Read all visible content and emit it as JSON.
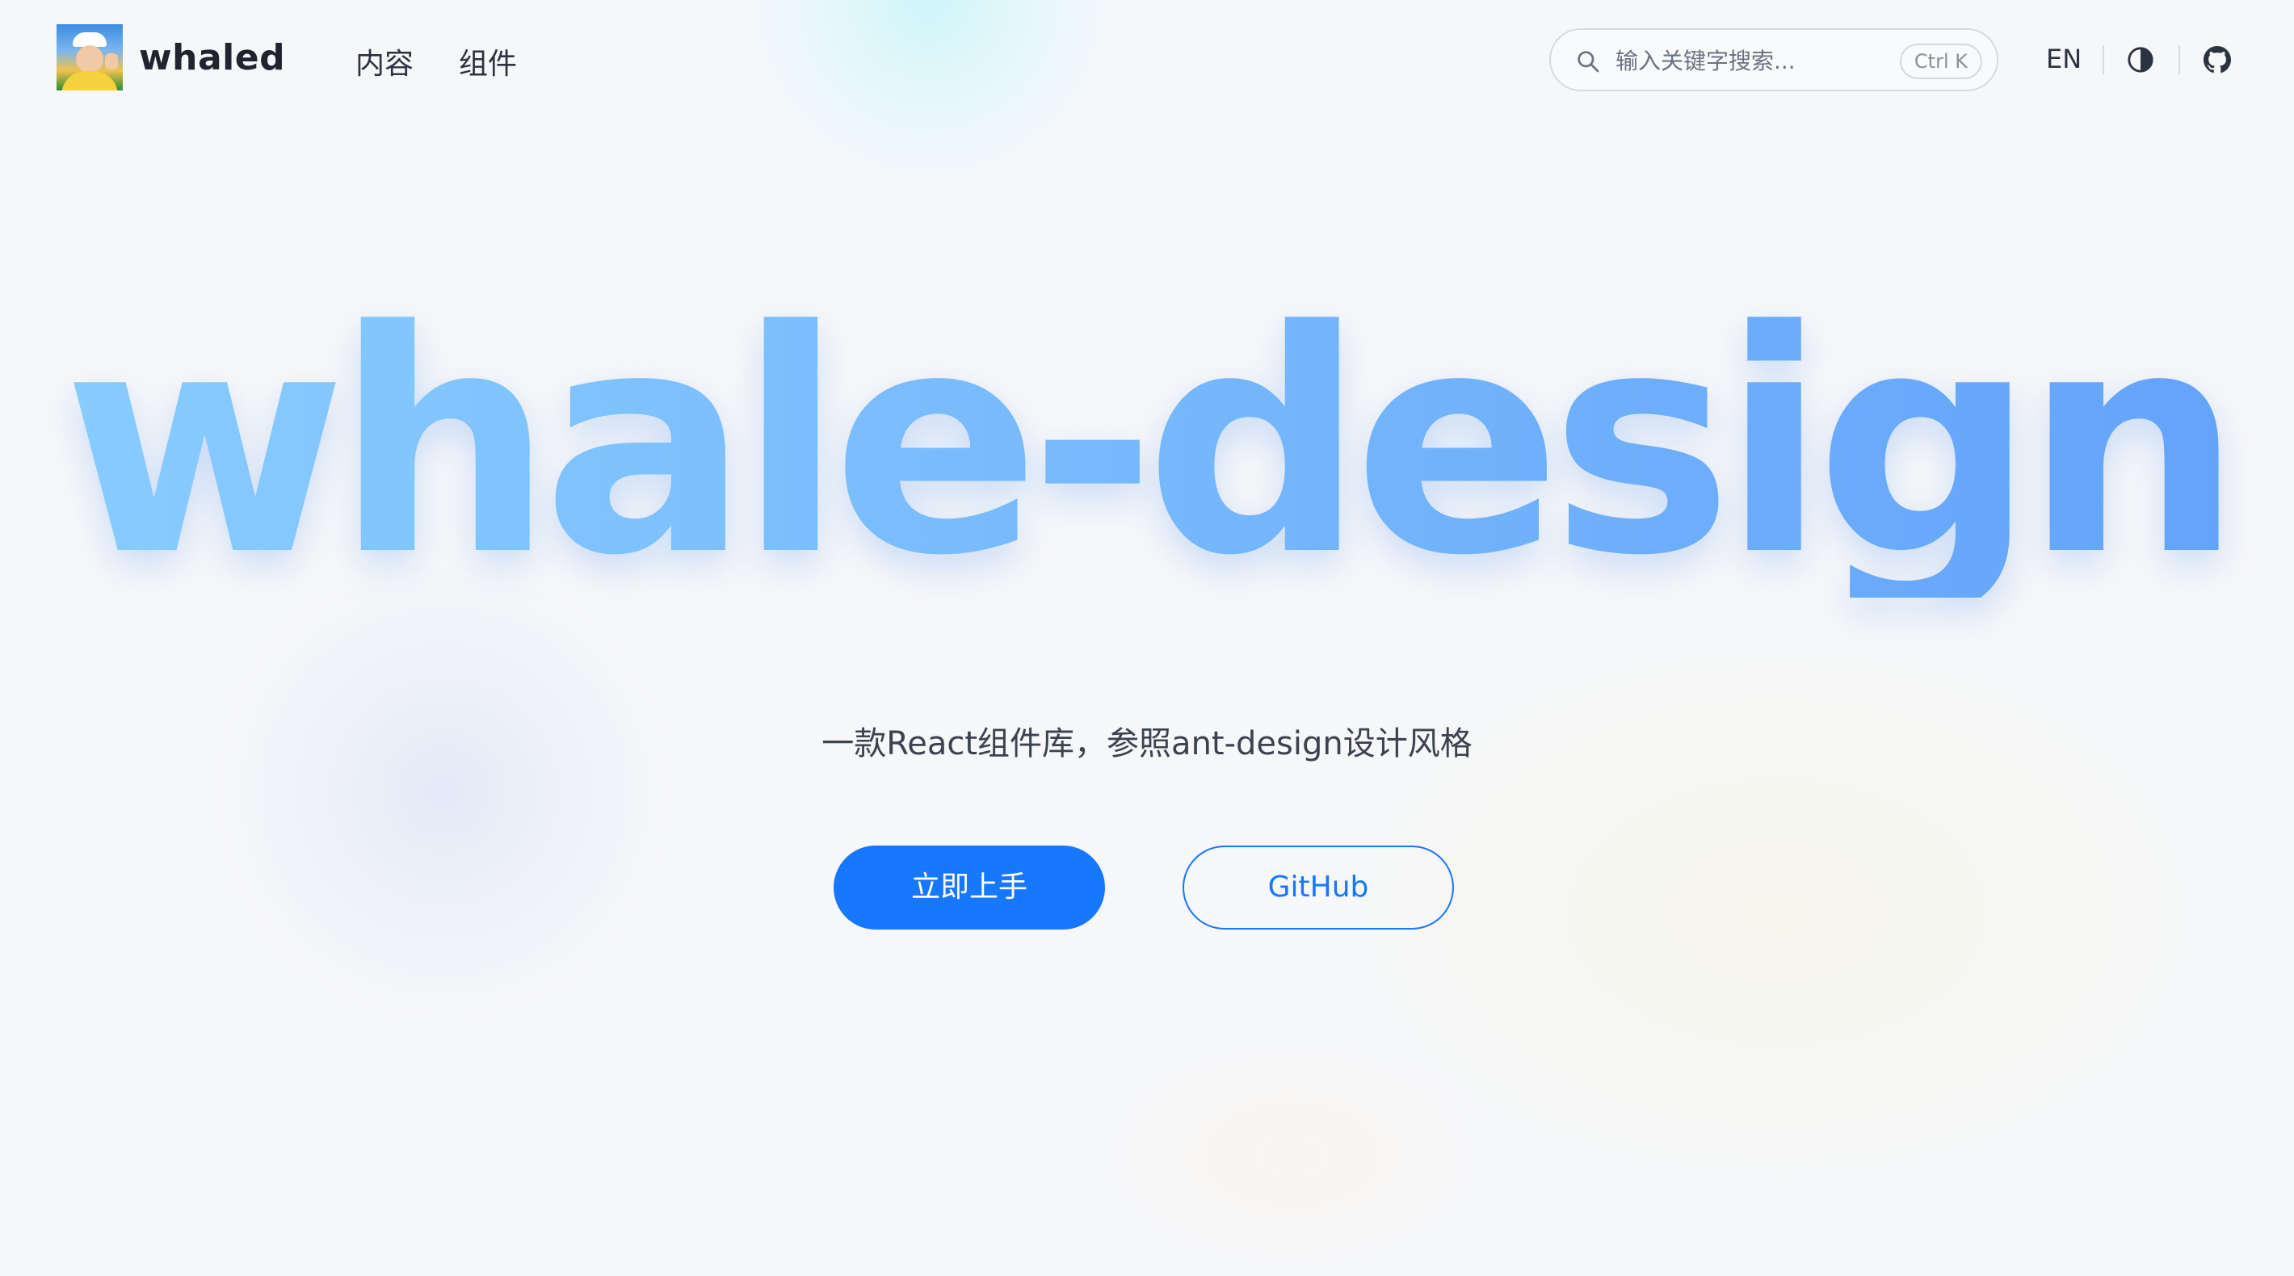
{
  "brand": {
    "name": "whaled",
    "avatar": "user-avatar"
  },
  "nav": {
    "items": [
      {
        "label": "内容"
      },
      {
        "label": "组件"
      }
    ]
  },
  "search": {
    "placeholder": "输入关键字搜索...",
    "shortcut": "Ctrl K",
    "icon": "search-icon"
  },
  "header_actions": {
    "language": "EN",
    "theme_icon": "contrast-icon",
    "github_icon": "github-icon"
  },
  "hero": {
    "title": "whale-design",
    "subtitle": "一款React组件库，参照ant-design设计风格",
    "primary_button": "立即上手",
    "secondary_button": "GitHub"
  },
  "colors": {
    "accent": "#1677ff",
    "title_gradient_start": "#88cdff",
    "title_gradient_end": "#62a2fb",
    "background": "#f6f7f9"
  }
}
